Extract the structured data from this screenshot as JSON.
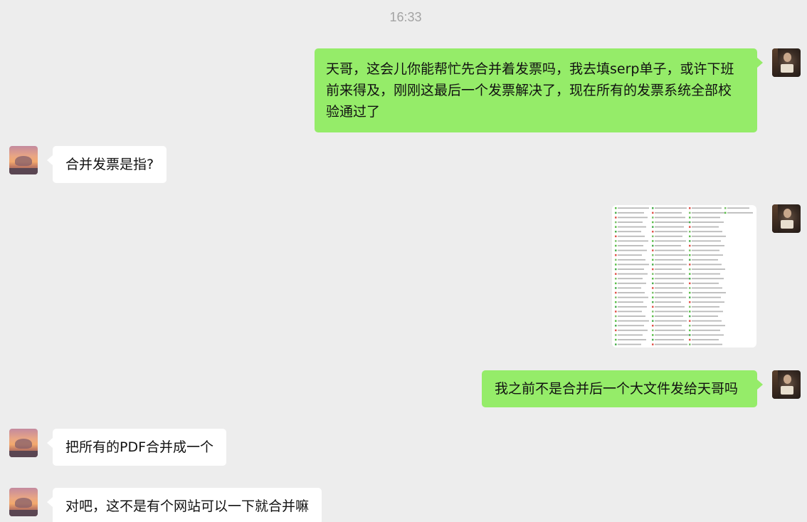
{
  "window": {
    "timestamp": "16:33"
  },
  "contacts": {
    "self_avatar": "person-reading-avatar",
    "other_avatar": "sunset-avatar"
  },
  "colors": {
    "background": "#ededed",
    "self_bubble": "#95ec69",
    "other_bubble": "#ffffff",
    "timestamp_text": "#a3a3a3"
  },
  "messages": [
    {
      "sender": "self",
      "type": "text",
      "lines": [
        "天哥，这会儿你能帮忙先合并着发票吗，我去填serp单子，或许下班",
        "前来得及，刚刚这最后一个发票解决了，现在所有的发票系统全部校",
        "验通过了"
      ]
    },
    {
      "sender": "other",
      "type": "text",
      "text": "合并发票是指?"
    },
    {
      "sender": "self",
      "type": "image",
      "image_description": "file-list-screenshot"
    },
    {
      "sender": "self",
      "type": "text",
      "text": "我之前不是合并后一个大文件发给天哥吗"
    },
    {
      "sender": "other",
      "type": "text",
      "text": "把所有的PDF合并成一个"
    },
    {
      "sender": "other",
      "type": "text",
      "text": "对吧，这不是有个网站可以一下就合并嘛"
    }
  ]
}
